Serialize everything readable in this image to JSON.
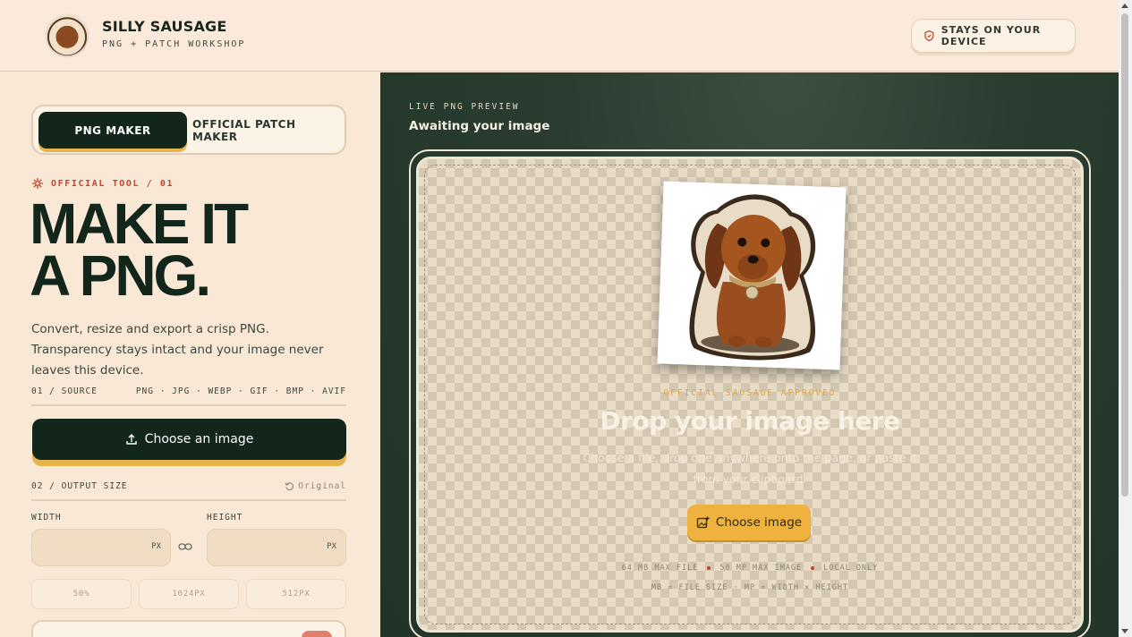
{
  "header": {
    "brand_name": "SILLY SAUSAGE",
    "brand_sub": "PNG + PATCH WORKSHOP",
    "device_badge": "STAYS ON YOUR DEVICE"
  },
  "tabs": [
    {
      "label": "PNG MAKER",
      "active": true
    },
    {
      "label": "OFFICIAL PATCH MAKER",
      "active": false
    }
  ],
  "tool": {
    "kicker": "OFFICIAL TOOL / 01",
    "headline_line1": "MAKE IT",
    "headline_line2": "A PNG.",
    "description": "Convert, resize and export a crisp PNG. Transparency stays intact and your image never leaves this device."
  },
  "source": {
    "label": "01 / SOURCE",
    "formats": "PNG · JPG · WEBP · GIF · BMP · AVIF",
    "button": "Choose an image"
  },
  "output": {
    "label": "02 / OUTPUT SIZE",
    "reset": "Original",
    "width_label": "WIDTH",
    "height_label": "HEIGHT",
    "width_value": "",
    "height_value": "",
    "unit": "PX",
    "presets": [
      "50%",
      "1024PX",
      "512PX"
    ]
  },
  "preview": {
    "label": "LIVE PNG PREVIEW",
    "status": "Awaiting your image",
    "approved": "OFFICIAL SAUSAGE APPROVED",
    "drop_title": "Drop your image here",
    "drop_sub": "Choose a file, drop one anywhere onto the page, or paste it from your clipboard.",
    "button": "Choose image",
    "limits": [
      "64 MB MAX FILE",
      "50 MP MAX IMAGE",
      "LOCAL ONLY"
    ],
    "legend": "MB = FILE SIZE · MP = WIDTH × HEIGHT"
  },
  "colors": {
    "dark_green": "#13261b",
    "accent_yellow": "#efb23e",
    "accent_red": "#c0462f",
    "cream": "#f9e8d5"
  }
}
